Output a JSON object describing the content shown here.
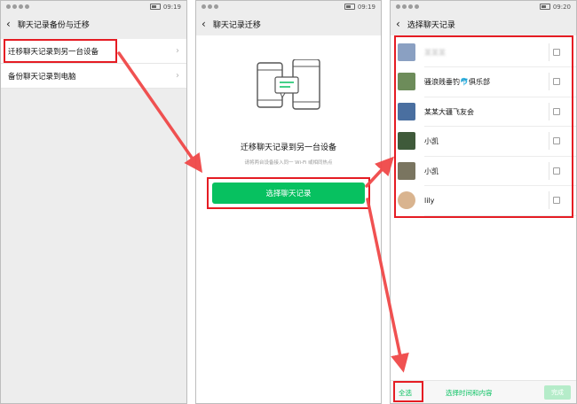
{
  "status": {
    "time1": "09:19",
    "time2": "09:19",
    "time3": "09:20"
  },
  "screen1": {
    "title": "聊天记录备份与迁移",
    "items": [
      {
        "label": "迁移聊天记录到另一台设备"
      },
      {
        "label": "备份聊天记录到电脑"
      }
    ]
  },
  "screen2": {
    "title": "聊天记录迁移",
    "heading": "迁移聊天记录到另一台设备",
    "hint": "请将两台设备接入同一 Wi-Fi 或相同热点",
    "button": "选择聊天记录"
  },
  "screen3": {
    "title": "选择聊天记录",
    "contacts": [
      {
        "name": "某某某",
        "blurred": true,
        "avatar": "#8aa0c2"
      },
      {
        "name": "骚浪贱垂钓🐬俱乐部",
        "blurred": false,
        "avatar": "#6d8c5a"
      },
      {
        "name": "某某大疆飞友会",
        "blurred_prefix": true,
        "avatar": "#4a6fa0"
      },
      {
        "name": "小凯",
        "blurred": false,
        "avatar": "#3f5a3a"
      },
      {
        "name": "小凯",
        "blurred": false,
        "avatar": "#7a7560"
      },
      {
        "name": "lily",
        "blurred": false,
        "avatar": "#d9b48f"
      }
    ],
    "select_all": "全选",
    "select_time": "选择时间和内容",
    "done": "完成"
  },
  "colors": {
    "accent": "#07c160",
    "highlight": "#e51c23",
    "arrow": "#f04848"
  }
}
